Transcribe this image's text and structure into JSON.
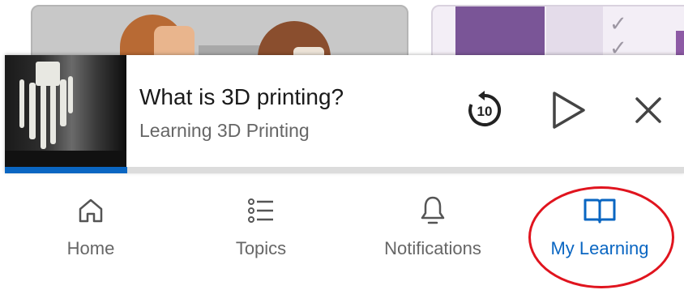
{
  "mini_player": {
    "title": "What is 3D printing?",
    "subtitle": "Learning 3D Printing",
    "rewind_seconds": "10",
    "progress_fraction": 0.18,
    "controls": {
      "rewind_icon": "rewind-10-icon",
      "play_icon": "play-icon",
      "close_icon": "close-icon"
    }
  },
  "bottom_nav": {
    "items": [
      {
        "label": "Home",
        "icon": "home-icon"
      },
      {
        "label": "Topics",
        "icon": "topics-list-icon"
      },
      {
        "label": "Notifications",
        "icon": "bell-icon"
      },
      {
        "label": "My Learning",
        "icon": "book-icon",
        "active": true
      }
    ]
  },
  "colors": {
    "accent": "#0a66c2",
    "text_primary": "#1a1a1a",
    "text_secondary": "#666666",
    "highlight_ring": "#e0141e"
  }
}
